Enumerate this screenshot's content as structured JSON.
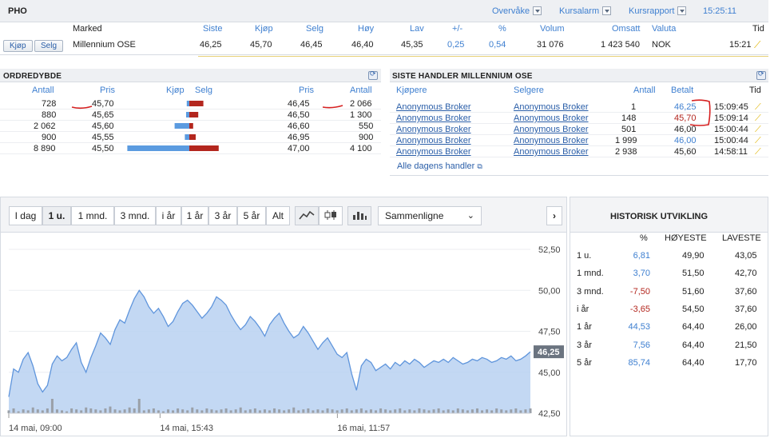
{
  "ticker": {
    "symbol": "PHO",
    "menu": [
      "Overvåke",
      "Kursalarm",
      "Kursrapport"
    ],
    "time": "15:25:11"
  },
  "quote": {
    "headers": [
      "Marked",
      "Siste",
      "Kjøp",
      "Selg",
      "Høy",
      "Lav",
      "+/-",
      "%",
      "Volum",
      "Omsatt",
      "Valuta",
      "Tid"
    ],
    "buy_label": "Kjøp",
    "sell_label": "Selg",
    "market": "Millennium OSE",
    "last": "46,25",
    "bid": "45,70",
    "ask": "46,45",
    "high": "46,40",
    "low": "45,35",
    "change": "0,25",
    "percent": "0,54",
    "volume": "31 076",
    "turnover": "1 423 540",
    "currency": "NOK",
    "time": "15:21"
  },
  "orderbook": {
    "title": "ORDREDYBDE",
    "headers": [
      "Antall",
      "Pris",
      "Kjøp",
      "Selg",
      "Pris",
      "Antall"
    ],
    "rows": [
      {
        "bid_qty": "728",
        "bid_price": "45,70",
        "ask_price": "46,45",
        "ask_qty": "2 066",
        "bid_bar": 0.04,
        "ask_bar": 0.22
      },
      {
        "bid_qty": "880",
        "bid_price": "45,65",
        "ask_price": "46,50",
        "ask_qty": "1 300",
        "bid_bar": 0.05,
        "ask_bar": 0.14
      },
      {
        "bid_qty": "2 062",
        "bid_price": "45,60",
        "ask_price": "46,60",
        "ask_qty": "550",
        "bid_bar": 0.23,
        "ask_bar": 0.06
      },
      {
        "bid_qty": "900",
        "bid_price": "45,55",
        "ask_price": "46,95",
        "ask_qty": "900",
        "bid_bar": 0.07,
        "ask_bar": 0.1
      },
      {
        "bid_qty": "8 890",
        "bid_price": "45,50",
        "ask_price": "47,00",
        "ask_qty": "4 100",
        "bid_bar": 0.97,
        "ask_bar": 0.46
      }
    ]
  },
  "trades": {
    "title": "SISTE HANDLER MILLENNIUM OSE",
    "headers": [
      "Kjøpere",
      "Selgere",
      "Antall",
      "Betalt",
      "Tid"
    ],
    "rows": [
      {
        "buyer": "Anonymous Broker",
        "seller": "Anonymous Broker",
        "qty": "1",
        "price": "46,25",
        "time": "15:09:45",
        "dir": "up"
      },
      {
        "buyer": "Anonymous Broker",
        "seller": "Anonymous Broker",
        "qty": "148",
        "price": "45,70",
        "time": "15:09:14",
        "dir": "down"
      },
      {
        "buyer": "Anonymous Broker",
        "seller": "Anonymous Broker",
        "qty": "501",
        "price": "46,00",
        "time": "15:00:44",
        "dir": "flat"
      },
      {
        "buyer": "Anonymous Broker",
        "seller": "Anonymous Broker",
        "qty": "1 999",
        "price": "46,00",
        "time": "15:00:44",
        "dir": "up"
      },
      {
        "buyer": "Anonymous Broker",
        "seller": "Anonymous Broker",
        "qty": "2 938",
        "price": "45,60",
        "time": "14:58:11",
        "dir": "flat"
      }
    ],
    "all_trades_link": "Alle dagens handler"
  },
  "chart_toolbar": {
    "periods": [
      "I dag",
      "1 u.",
      "1 mnd.",
      "3 mnd.",
      "i år",
      "1 år",
      "3 år",
      "5 år",
      "Alt"
    ],
    "active_period": "1 u.",
    "compare_label": "Sammenligne"
  },
  "chart_data": {
    "type": "area",
    "ylim": [
      42.5,
      52.5
    ],
    "yticks": [
      "52,50",
      "50,00",
      "47,50",
      "45,00",
      "42,50"
    ],
    "ytick_values": [
      52.5,
      50,
      47.5,
      45,
      42.5
    ],
    "xticks": [
      "14 mai, 09:00",
      "14 mai, 15:43",
      "16 mai, 11:57"
    ],
    "xtick_positions": [
      0,
      0.29,
      0.63
    ],
    "last_label": "46,25",
    "values": [
      43.5,
      45.2,
      45.0,
      45.8,
      46.2,
      45.4,
      44.3,
      43.8,
      44.2,
      45.5,
      46.0,
      45.7,
      45.9,
      46.4,
      46.8,
      45.6,
      45.0,
      45.9,
      46.6,
      47.4,
      47.1,
      46.7,
      47.6,
      48.2,
      48.0,
      48.8,
      49.5,
      50.0,
      49.6,
      49.0,
      48.6,
      48.9,
      48.4,
      47.8,
      48.1,
      48.7,
      49.2,
      49.4,
      49.1,
      48.7,
      48.3,
      48.6,
      49.0,
      49.6,
      49.4,
      49.1,
      48.5,
      48.0,
      47.6,
      47.9,
      48.4,
      48.1,
      47.7,
      47.2,
      47.9,
      48.3,
      48.6,
      48.0,
      47.5,
      47.1,
      47.3,
      47.8,
      47.4,
      46.9,
      46.4,
      46.8,
      47.1,
      46.6,
      46.1,
      45.9,
      46.2,
      44.9,
      43.9,
      45.4,
      45.8,
      45.6,
      45.1,
      45.3,
      45.5,
      45.2,
      45.6,
      45.4,
      45.7,
      45.5,
      45.8,
      45.6,
      45.3,
      45.5,
      45.7,
      45.6,
      45.8,
      45.6,
      45.9,
      45.7,
      45.5,
      45.6,
      45.8,
      45.7,
      45.9,
      45.8,
      45.6,
      45.7,
      45.9,
      45.8,
      46.0,
      45.7,
      45.8,
      46.0,
      46.25
    ],
    "volume": [
      0.3,
      0.5,
      0.2,
      0.4,
      0.3,
      0.6,
      0.4,
      0.3,
      0.5,
      0.8,
      0.4,
      0.3,
      0.2,
      0.5,
      0.4,
      0.3,
      0.6,
      0.5,
      0.4,
      0.3,
      0.5,
      0.7,
      0.4,
      0.3,
      0.4,
      0.6,
      0.5,
      0.9,
      0.3,
      0.4,
      0.5,
      0.3,
      0.2,
      0.4,
      0.3,
      0.5,
      0.4,
      0.3,
      0.6,
      0.4,
      0.3,
      0.5,
      0.4,
      0.3,
      0.4,
      0.5,
      0.3,
      0.4,
      0.6,
      0.3,
      0.4,
      0.5,
      0.3,
      0.4,
      0.3,
      0.5,
      0.4,
      0.3,
      0.4,
      0.6,
      0.3,
      0.4,
      0.5,
      0.3,
      0.4,
      0.3,
      0.5,
      0.4,
      0.3,
      0.4,
      0.5,
      0.3,
      0.4,
      0.5,
      0.3,
      0.4,
      0.3,
      0.5,
      0.4,
      0.3,
      0.4,
      0.5,
      0.3,
      0.4,
      0.3,
      0.5,
      0.4,
      0.3,
      0.4,
      0.5,
      0.3,
      0.4,
      0.3,
      0.5,
      0.4,
      0.3,
      0.4,
      0.5,
      0.3,
      0.4,
      0.3,
      0.5,
      0.4,
      0.3,
      0.4,
      0.5,
      0.3,
      0.4,
      0.5
    ],
    "colors": {
      "line": "#5f95dc",
      "fill": "#b9d1f1",
      "volume": "#9aa0a8",
      "bid_bar": "#5b9be0",
      "ask_bar": "#b3261e"
    }
  },
  "historical": {
    "title": "HISTORISK UTVIKLING",
    "headers": [
      "%",
      "HØYESTE",
      "LAVESTE"
    ],
    "rows": [
      {
        "period": "1 u.",
        "pct": "6,81",
        "high": "49,90",
        "low": "43,05",
        "dir": "up"
      },
      {
        "period": "1 mnd.",
        "pct": "3,70",
        "high": "51,50",
        "low": "42,70",
        "dir": "up"
      },
      {
        "period": "3 mnd.",
        "pct": "-7,50",
        "high": "51,60",
        "low": "37,60",
        "dir": "down"
      },
      {
        "period": "i år",
        "pct": "-3,65",
        "high": "54,50",
        "low": "37,60",
        "dir": "down"
      },
      {
        "period": "1 år",
        "pct": "44,53",
        "high": "64,40",
        "low": "26,00",
        "dir": "up"
      },
      {
        "period": "3 år",
        "pct": "7,56",
        "high": "64,40",
        "low": "21,50",
        "dir": "up"
      },
      {
        "period": "5 år",
        "pct": "85,74",
        "high": "64,40",
        "low": "17,70",
        "dir": "up"
      }
    ]
  }
}
